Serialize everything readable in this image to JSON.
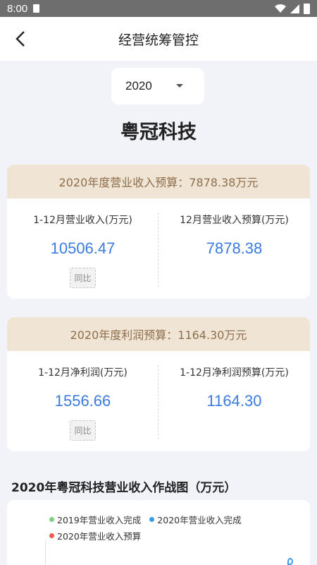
{
  "status_bar": {
    "time": "8:00"
  },
  "header": {
    "title": "经营统筹管控"
  },
  "year_select": {
    "value": "2020"
  },
  "company": {
    "name": "粤冠科技"
  },
  "revenue_card": {
    "title": "2020年度营业收入预算：7878.38万元",
    "left_label": "1-12月营业收入(万元)",
    "left_value": "10506.47",
    "right_label": "12月营业收入预算(万元)",
    "right_value": "7878.38",
    "tag": "同比"
  },
  "profit_card": {
    "title": "2020年度利润预算：1164.30万元",
    "left_label": "1-12月净利润(万元)",
    "left_value": "1556.66",
    "right_label": "1-12月净利润预算(万元)",
    "right_value": "1164.30",
    "tag": "同比"
  },
  "chart_section": {
    "title": "2020年粤冠科技营业收入作战图（万元）",
    "legend": [
      {
        "label": "2019年营业收入完成",
        "color": "#7ed07e"
      },
      {
        "label": "2020年营业收入完成",
        "color": "#3a9bea"
      },
      {
        "label": "2020年营业收入预算",
        "color": "#ef5b4f"
      }
    ]
  },
  "colors": {
    "accent": "#3a7be0",
    "card_head_bg": "#f0e4d4",
    "card_head_text": "#8d6e4c"
  }
}
